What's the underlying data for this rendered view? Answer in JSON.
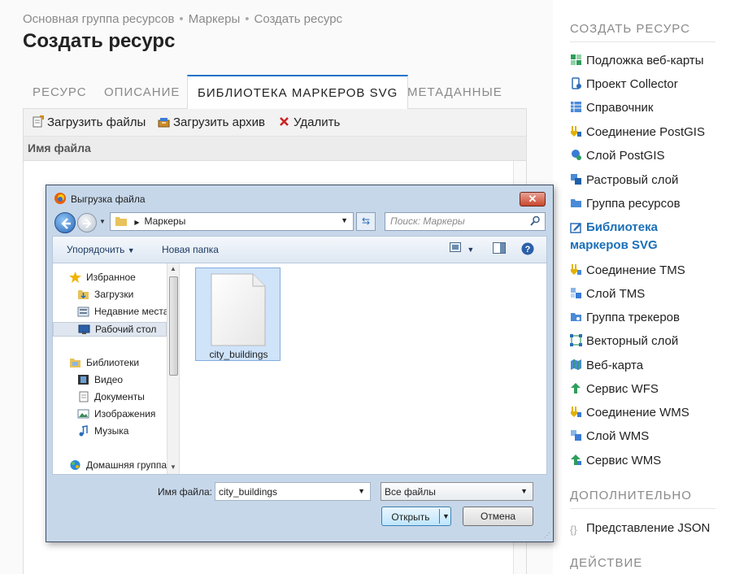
{
  "breadcrumb": [
    "Основная группа ресурсов",
    "Маркеры",
    "Создать ресурс"
  ],
  "page_title": "Создать ресурс",
  "tabs": [
    {
      "label": "Ресурс"
    },
    {
      "label": "Описание"
    },
    {
      "label": "Библиотека маркеров SVG"
    },
    {
      "label": "Метаданные"
    }
  ],
  "toolbar": {
    "upload_files": "Загрузить файлы",
    "upload_archive": "Загрузить архив",
    "delete": "Удалить"
  },
  "file_list": {
    "column_header": "Имя файла"
  },
  "sidebar": {
    "create_heading": "Создать ресурс",
    "items": [
      {
        "label": "Подложка веб-карты",
        "icon": "basemap-icon"
      },
      {
        "label": "Проект Collector",
        "icon": "collector-icon"
      },
      {
        "label": "Справочник",
        "icon": "lookup-table-icon"
      },
      {
        "label": "Соединение PostGIS",
        "icon": "postgis-connection-icon"
      },
      {
        "label": "Слой PostGIS",
        "icon": "postgis-layer-icon"
      },
      {
        "label": "Растровый слой",
        "icon": "raster-layer-icon"
      },
      {
        "label": "Группа ресурсов",
        "icon": "folder-icon"
      },
      {
        "label": "Библиотека маркеров SVG",
        "icon": "svg-marker-library-icon"
      },
      {
        "label": "Соединение TMS",
        "icon": "tms-connection-icon"
      },
      {
        "label": "Слой TMS",
        "icon": "tms-layer-icon"
      },
      {
        "label": "Группа трекеров",
        "icon": "tracker-group-icon"
      },
      {
        "label": "Векторный слой",
        "icon": "vector-layer-icon"
      },
      {
        "label": "Веб-карта",
        "icon": "webmap-icon"
      },
      {
        "label": "Сервис WFS",
        "icon": "wfs-service-icon"
      },
      {
        "label": "Соединение WMS",
        "icon": "wms-connection-icon"
      },
      {
        "label": "Слой WMS",
        "icon": "wms-layer-icon"
      },
      {
        "label": "Сервис WMS",
        "icon": "wms-service-icon"
      }
    ],
    "extra_heading": "Дополнительно",
    "extra_items": [
      {
        "label": "Представление JSON",
        "icon": "json-braces-icon"
      }
    ],
    "action_heading": "Действие"
  },
  "dialog": {
    "title": "Выгрузка файла",
    "address": "Маркеры",
    "search_placeholder": "Поиск: Маркеры",
    "organize": "Упорядочить",
    "new_folder": "Новая папка",
    "tree": [
      {
        "label": "Избранное",
        "icon": "star-icon"
      },
      {
        "label": "Загрузки",
        "icon": "downloads-icon"
      },
      {
        "label": "Недавние места",
        "icon": "recent-places-icon"
      },
      {
        "label": "Рабочий стол",
        "icon": "desktop-icon"
      },
      {
        "label": "Библиотеки",
        "icon": "libraries-icon"
      },
      {
        "label": "Видео",
        "icon": "video-icon"
      },
      {
        "label": "Документы",
        "icon": "documents-icon"
      },
      {
        "label": "Изображения",
        "icon": "pictures-icon"
      },
      {
        "label": "Музыка",
        "icon": "music-icon"
      },
      {
        "label": "Домашняя группа",
        "icon": "homegroup-icon"
      }
    ],
    "files": [
      {
        "name": "city_buildings"
      }
    ],
    "filename_label": "Имя файла:",
    "filename_value": "city_buildings",
    "filter": "Все файлы",
    "open": "Открыть",
    "cancel": "Отмена"
  },
  "colors": {
    "accent": "#1a73c8",
    "sidebar_active": "#1a6fb8"
  }
}
